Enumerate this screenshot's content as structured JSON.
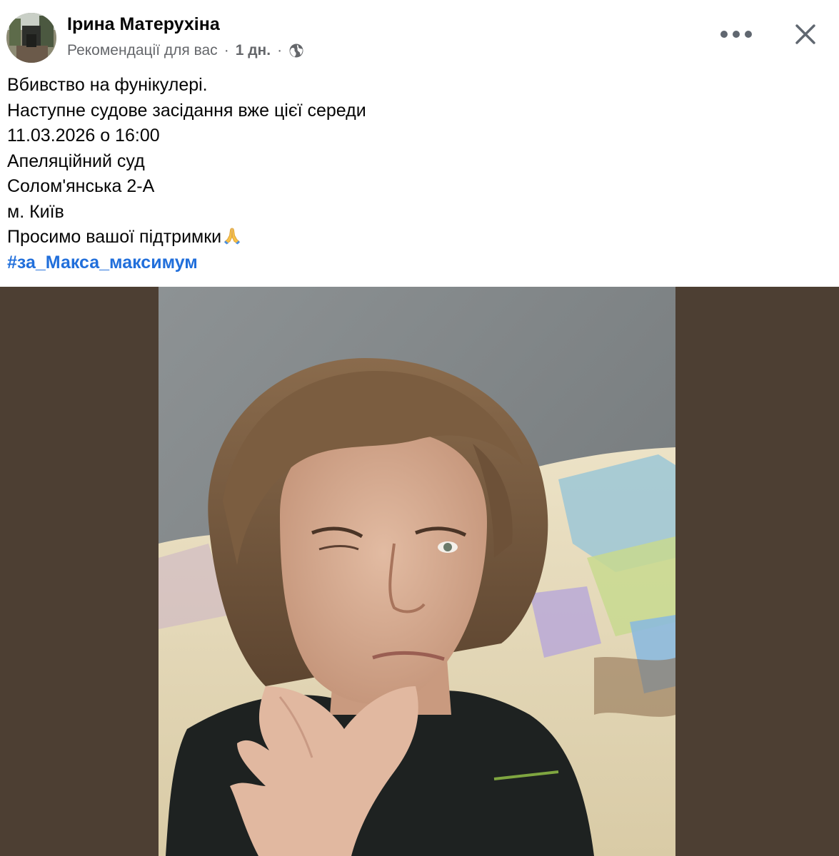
{
  "post": {
    "author_name": "Ірина Матерухіна",
    "audience_label": "Рекомендації для вас",
    "separator": "·",
    "time_label": "1 дн.",
    "privacy_icon": "globe-icon",
    "more_icon": "more-horizontal-icon",
    "close_icon": "close-icon",
    "text_lines": [
      "Вбивство на фунікулері.",
      "Наступне судове засідання вже цієї середи",
      "11.03.2026 о 16:00",
      "Апеляційний суд",
      "Солом'янська 2-А",
      "м. Київ",
      "Просимо вашої підтримки"
    ],
    "emoji": "🙏",
    "hashtag": "#за_Макса_максимум",
    "media": {
      "type": "photo",
      "description_icon": "photo"
    }
  },
  "colors": {
    "text": "#050505",
    "secondary_text": "#65676b",
    "link": "#216fdb",
    "media_background": "#4d3f33"
  }
}
